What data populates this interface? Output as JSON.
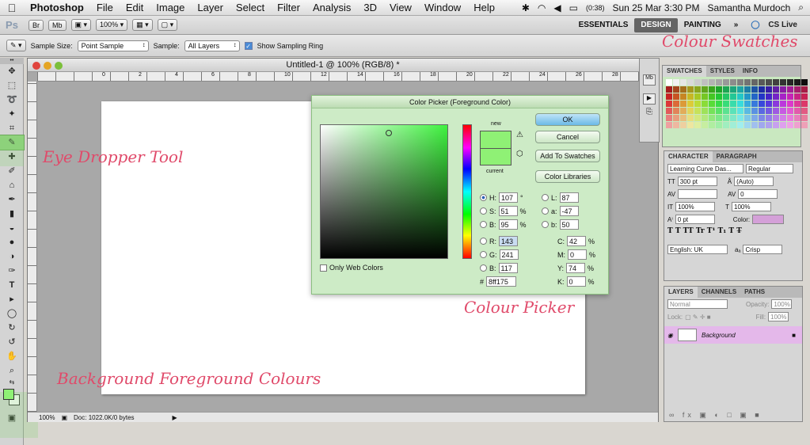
{
  "menubar": {
    "apple": "",
    "app": "Photoshop",
    "items": [
      "File",
      "Edit",
      "Image",
      "Layer",
      "Select",
      "Filter",
      "Analysis",
      "3D",
      "View",
      "Window",
      "Help"
    ],
    "battery": "(0:38)",
    "datetime": "Sun 25 Mar 3:30 PM",
    "user": "Samantha Murdoch"
  },
  "appbar": {
    "logo": "Ps",
    "br": "Br",
    "mb": "Mb",
    "zoom": "100% ▾",
    "workspaces": [
      "ESSENTIALS",
      "DESIGN",
      "PAINTING",
      "»"
    ],
    "active_workspace": "DESIGN",
    "cslive": "CS Live"
  },
  "optbar": {
    "sample_size_label": "Sample Size:",
    "sample_size_value": "Point Sample",
    "sample_label": "Sample:",
    "sample_value": "All Layers",
    "ring_label": "Show Sampling Ring"
  },
  "document": {
    "title": "Untitled-1 @ 100% (RGB/8) *",
    "ruler_labels": [
      "0",
      "2",
      "4",
      "6",
      "8",
      "10",
      "12",
      "14",
      "16",
      "18",
      "20",
      "22",
      "24",
      "26",
      "28"
    ],
    "zoom": "100%",
    "doc_info": "Doc: 1022.0K/0 bytes"
  },
  "picker": {
    "title": "Color Picker (Foreground Color)",
    "new_label": "new",
    "current_label": "current",
    "ok": "OK",
    "cancel": "Cancel",
    "add_swatches": "Add To Swatches",
    "libraries": "Color Libraries",
    "only_web": "Only Web Colors",
    "h_label": "H:",
    "h": "107",
    "h_unit": "°",
    "s_label": "S:",
    "s": "51",
    "s_unit": "%",
    "b_label": "B:",
    "b": "95",
    "b_unit": "%",
    "r_label": "R:",
    "r": "143",
    "g_label": "G:",
    "g": "241",
    "bb_label": "B:",
    "bb": "117",
    "l_label": "L:",
    "l": "87",
    "a_label": "a:",
    "a": "-47",
    "lb_label": "b:",
    "lb": "50",
    "c_label": "C:",
    "c": "42",
    "m_label": "M:",
    "m": "0",
    "y_label": "Y:",
    "y": "74",
    "k_label": "K:",
    "k": "0",
    "pct": "%",
    "hash": "#",
    "hex": "8ff175",
    "color": "#8ff175"
  },
  "panels": {
    "swatches_tabs": [
      "SWATCHES",
      "STYLES",
      "INFO"
    ],
    "character_tabs": [
      "CHARACTER",
      "PARAGRAPH"
    ],
    "font_family": "Learning Curve Das...",
    "font_style": "Regular",
    "font_size": "300 pt",
    "leading": "(Auto)",
    "tracking": "0",
    "vscale": "100%",
    "hscale": "100%",
    "baseline": "0 pt",
    "color_label": "Color:",
    "text_color": "#d4a0d8",
    "style_glyphs": "T  T  TT Tr T¹ T₁  T  T̶",
    "language": "English: UK",
    "aa_icon": "aₐ",
    "aa": "Crisp",
    "layers_tabs": [
      "LAYERS",
      "CHANNELS",
      "PATHS"
    ],
    "blend": "Normal",
    "opacity_label": "Opacity:",
    "opacity": "100%",
    "lock_label": "Lock:",
    "fill_label": "Fill:",
    "fill": "100%",
    "layer_name": "Background"
  },
  "annotations": {
    "swatches": "Colour Swatches",
    "dropper": "Eye Dropper Tool",
    "picker": "Colour Picker",
    "bgfg": "Background Foreground Colours"
  },
  "colors": {
    "accent": "#e04a6a",
    "highlight": "#8fd27c"
  }
}
